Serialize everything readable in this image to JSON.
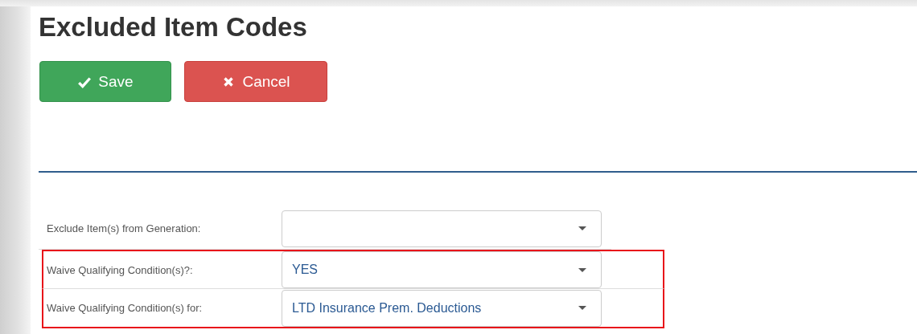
{
  "page": {
    "title": "Excluded Item Codes"
  },
  "buttons": [
    {
      "kind": "save",
      "label": "Save"
    },
    {
      "kind": "cancel",
      "label": "Cancel"
    }
  ],
  "fields": [
    {
      "label": "Exclude Item(s) from Generation:",
      "highlighted": false
    },
    {
      "label": "Waive Qualifying Condition(s)?:",
      "value": "YES",
      "highlighted": true
    },
    {
      "label": "Waive Qualifying Condition(s) for:",
      "value": "LTD Insurance Prem. Deductions",
      "highlighted": true
    }
  ]
}
